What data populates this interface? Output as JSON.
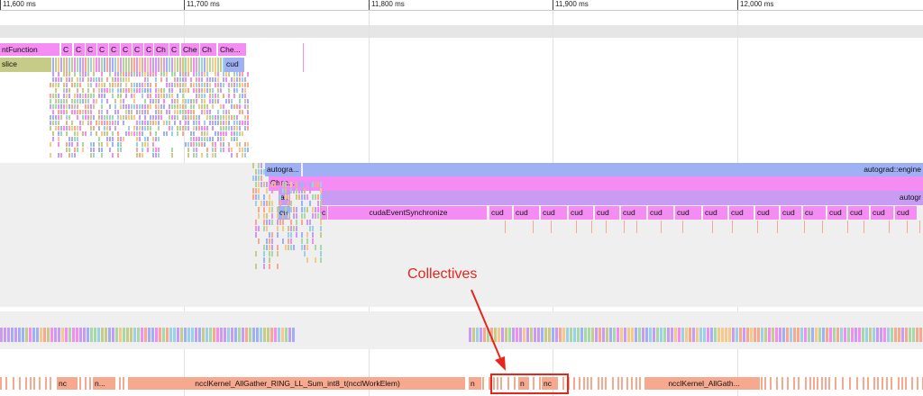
{
  "timeline": {
    "ticks": [
      "11,600 ms",
      "11,700 ms",
      "11,800 ms",
      "11,900 ms",
      "12,000 ms"
    ]
  },
  "colors": {
    "pink": "#f48cf4",
    "violet": "#c79cf2",
    "lavender": "#9fb0f5",
    "olive": "#c6cb87",
    "salmon": "#f6a98e",
    "annotation": "#e8251b",
    "band_gray": "#efefef"
  },
  "thread_1": {
    "slices": [
      "ntFunction",
      "C",
      "C",
      "C",
      "C",
      "C",
      "C",
      "C",
      "C",
      "Ch",
      "C",
      "Che",
      "Ch",
      "Che...",
      "slice",
      "cud"
    ]
  },
  "thread_2": {
    "slices": [
      "autogra...",
      "autograd::engine",
      "Chec...",
      "au",
      "autogr",
      "cu",
      "c",
      "cudaEventSynchronize",
      "cud",
      "cud",
      "cud",
      "cud",
      "cud",
      "cud",
      "cud",
      "cud",
      "cud",
      "cud",
      "cud",
      "cud",
      "cu",
      "cud",
      "cud",
      "cud"
    ]
  },
  "gpu_stream": {
    "slices": [
      "nc",
      "n...",
      "ncclKernel_AllGather_RING_LL_Sum_int8_t(ncclWorkElem)",
      "n",
      "n",
      "nc",
      "ncclKernel_AllGath..."
    ]
  },
  "annotation": {
    "label": "Collectives"
  }
}
